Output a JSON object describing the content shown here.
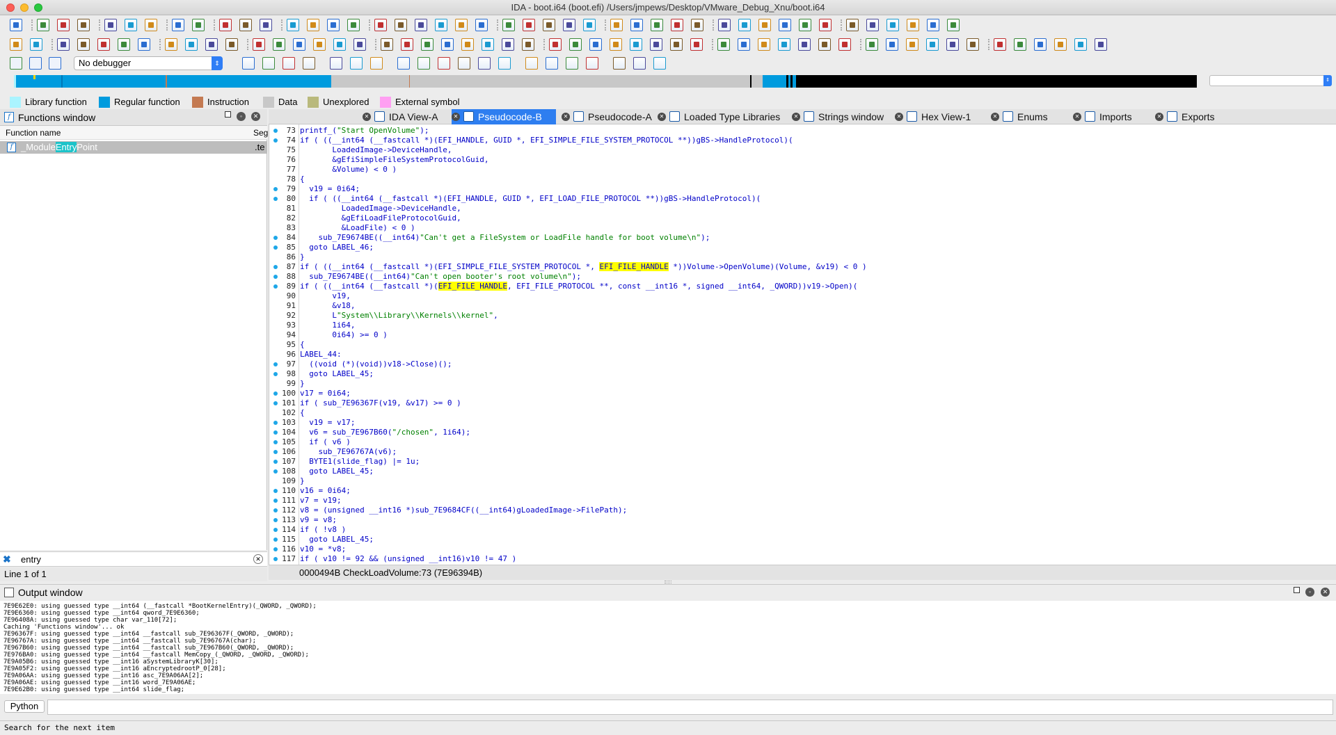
{
  "window": {
    "title": "IDA - boot.i64 (boot.efi) /Users/jmpews/Desktop/VMware_Debug_Xnu/boot.i64"
  },
  "debugger": {
    "selected": "No debugger"
  },
  "legend": [
    {
      "label": "Library function",
      "color": "#aaf4ff"
    },
    {
      "label": "Regular function",
      "color": "#009bde"
    },
    {
      "label": "Instruction",
      "color": "#c47a52"
    },
    {
      "label": "Data",
      "color": "#c8c8c8"
    },
    {
      "label": "Unexplored",
      "color": "#b9b97c"
    },
    {
      "label": "External symbol",
      "color": "#ff9ff2"
    }
  ],
  "functions_window": {
    "title": "Functions window",
    "col_name": "Function name",
    "col_seg": "Seg",
    "row": {
      "pre": "_Module",
      "hl": "Entry",
      "post": "Point",
      "seg": ".te"
    },
    "search_value": "entry",
    "status": "Line 1 of 1"
  },
  "tabs": [
    {
      "label": "IDA View-A",
      "active": false
    },
    {
      "label": "Pseudocode-B",
      "active": true
    },
    {
      "label": "Pseudocode-A",
      "active": false
    },
    {
      "label": "Loaded Type Libraries",
      "active": false
    },
    {
      "label": "Strings window",
      "active": false
    },
    {
      "label": "Hex View-1",
      "active": false
    },
    {
      "label": "Enums",
      "active": false
    },
    {
      "label": "Imports",
      "active": false
    },
    {
      "label": "Exports",
      "active": false
    }
  ],
  "code_lines": [
    {
      "n": "73",
      "d": true,
      "t": "printf_(\"Start OpenVolume\");"
    },
    {
      "n": "74",
      "d": true,
      "t": "if ( ((__int64 (__fastcall *)(EFI_HANDLE, GUID *, EFI_SIMPLE_FILE_SYSTEM_PROTOCOL **))gBS->HandleProtocol)("
    },
    {
      "n": "75",
      "d": false,
      "t": "       LoadedImage->DeviceHandle,"
    },
    {
      "n": "76",
      "d": false,
      "t": "       &gEfiSimpleFileSystemProtocolGuid,"
    },
    {
      "n": "77",
      "d": false,
      "t": "       &Volume) < 0 )"
    },
    {
      "n": "78",
      "d": false,
      "t": "{"
    },
    {
      "n": "79",
      "d": true,
      "t": "  v19 = 0i64;"
    },
    {
      "n": "80",
      "d": true,
      "t": "  if ( ((__int64 (__fastcall *)(EFI_HANDLE, GUID *, EFI_LOAD_FILE_PROTOCOL **))gBS->HandleProtocol)("
    },
    {
      "n": "81",
      "d": false,
      "t": "         LoadedImage->DeviceHandle,"
    },
    {
      "n": "82",
      "d": false,
      "t": "         &gEfiLoadFileProtocolGuid,"
    },
    {
      "n": "83",
      "d": false,
      "t": "         &LoadFile) < 0 )"
    },
    {
      "n": "84",
      "d": true,
      "t": "    sub_7E9674BE((__int64)\"Can't get a FileSystem or LoadFile handle for boot volume\\n\");"
    },
    {
      "n": "85",
      "d": true,
      "t": "  goto LABEL_46;"
    },
    {
      "n": "86",
      "d": false,
      "t": "}"
    },
    {
      "n": "87",
      "d": true,
      "t": "if ( ((__int64 (__fastcall *)(EFI_SIMPLE_FILE_SYSTEM_PROTOCOL *, EFI_FILE_HANDLE *))Volume->OpenVolume)(Volume, &v19) < 0 )"
    },
    {
      "n": "88",
      "d": true,
      "t": "  sub_7E9674BE((__int64)\"Can't open booter's root volume\\n\");"
    },
    {
      "n": "89",
      "d": true,
      "t": "if ( ((__int64 (__fastcall *)(EFI_FILE_HANDLE, EFI_FILE_PROTOCOL **, const __int16 *, signed __int64, _QWORD))v19->Open)("
    },
    {
      "n": "90",
      "d": false,
      "t": "       v19,"
    },
    {
      "n": "91",
      "d": false,
      "t": "       &v18,"
    },
    {
      "n": "92",
      "d": false,
      "t": "       L\"System\\\\Library\\\\Kernels\\\\kernel\","
    },
    {
      "n": "93",
      "d": false,
      "t": "       1i64,"
    },
    {
      "n": "94",
      "d": false,
      "t": "       0i64) >= 0 )"
    },
    {
      "n": "95",
      "d": false,
      "t": "{"
    },
    {
      "n": "96",
      "d": false,
      "t": "LABEL_44:"
    },
    {
      "n": "97",
      "d": true,
      "t": "  ((void (*)(void))v18->Close)();"
    },
    {
      "n": "98",
      "d": true,
      "t": "  goto LABEL_45;"
    },
    {
      "n": "99",
      "d": false,
      "t": "}"
    },
    {
      "n": "100",
      "d": true,
      "t": "v17 = 0i64;"
    },
    {
      "n": "101",
      "d": true,
      "t": "if ( sub_7E96367F(v19, &v17) >= 0 )"
    },
    {
      "n": "102",
      "d": false,
      "t": "{"
    },
    {
      "n": "103",
      "d": true,
      "t": "  v19 = v17;"
    },
    {
      "n": "104",
      "d": true,
      "t": "  v6 = sub_7E967B60(\"/chosen\", 1i64);"
    },
    {
      "n": "105",
      "d": true,
      "t": "  if ( v6 )"
    },
    {
      "n": "106",
      "d": true,
      "t": "    sub_7E96767A(v6);"
    },
    {
      "n": "107",
      "d": true,
      "t": "  BYTE1(slide_flag) |= 1u;"
    },
    {
      "n": "108",
      "d": true,
      "t": "  goto LABEL_45;"
    },
    {
      "n": "109",
      "d": false,
      "t": "}"
    },
    {
      "n": "110",
      "d": true,
      "t": "v16 = 0i64;"
    },
    {
      "n": "111",
      "d": true,
      "t": "v7 = v19;"
    },
    {
      "n": "112",
      "d": true,
      "t": "v8 = (unsigned __int16 *)sub_7E9684CF((__int64)gLoadedImage->FilePath);"
    },
    {
      "n": "113",
      "d": true,
      "t": "v9 = v8;"
    },
    {
      "n": "114",
      "d": true,
      "t": "if ( !v8 )"
    },
    {
      "n": "115",
      "d": true,
      "t": "  goto LABEL_45;"
    },
    {
      "n": "116",
      "d": true,
      "t": "v10 = *v8;"
    },
    {
      "n": "117",
      "d": true,
      "t": "if ( v10 != 92 && (unsigned __int16)v10 != 47 )"
    }
  ],
  "code_status": "0000494B  CheckLoadVolume:73 (7E96394B)",
  "output_window": {
    "title": "Output window",
    "lines": [
      "7E9E62E0: using guessed type __int64 (__fastcall *BootKernelEntry)(_QWORD, _QWORD);",
      "7E9E6360: using guessed type __int64 qword_7E9E6360;",
      "7E96408A: using guessed type char var_110[72];",
      "Caching 'Functions window'... ok",
      "7E96367F: using guessed type __int64 __fastcall sub_7E96367F(_QWORD, _QWORD);",
      "7E96767A: using guessed type __int64 __fastcall sub_7E96767A(char);",
      "7E967B60: using guessed type __int64 __fastcall sub_7E967B60(_QWORD, _QWORD);",
      "7E976BA0: using guessed type __int64 __fastcall MemCopy_(_QWORD, _QWORD, _QWORD);",
      "7E9A05B6: using guessed type __int16 aSystemLibraryK[30];",
      "7E9A05F2: using guessed type __int16 aEncryptedrootP_0[28];",
      "7E9A06AA: using guessed type __int16 asc_7E9A06AA[2];",
      "7E9A06AE: using guessed type __int16 word_7E9A06AE;",
      "7E9E62B0: using guessed type __int64 slide_flag;"
    ]
  },
  "python": {
    "label": "Python"
  },
  "statusbar": {
    "text": "Search for the next item"
  }
}
